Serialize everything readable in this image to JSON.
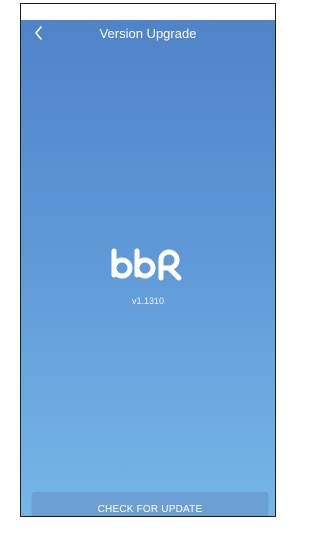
{
  "header": {
    "title": "Version Upgrade",
    "back_icon": "chevron-left-icon"
  },
  "brand": {
    "logo_text": "bbR",
    "version": "v1.1310"
  },
  "actions": {
    "check_update_label": "CHECK FOR UPDATE"
  },
  "colors": {
    "gradient_top": "#4f82c8",
    "gradient_bottom": "#76b6e6",
    "button_bg": "#6c9fd4",
    "text": "#ffffff"
  }
}
